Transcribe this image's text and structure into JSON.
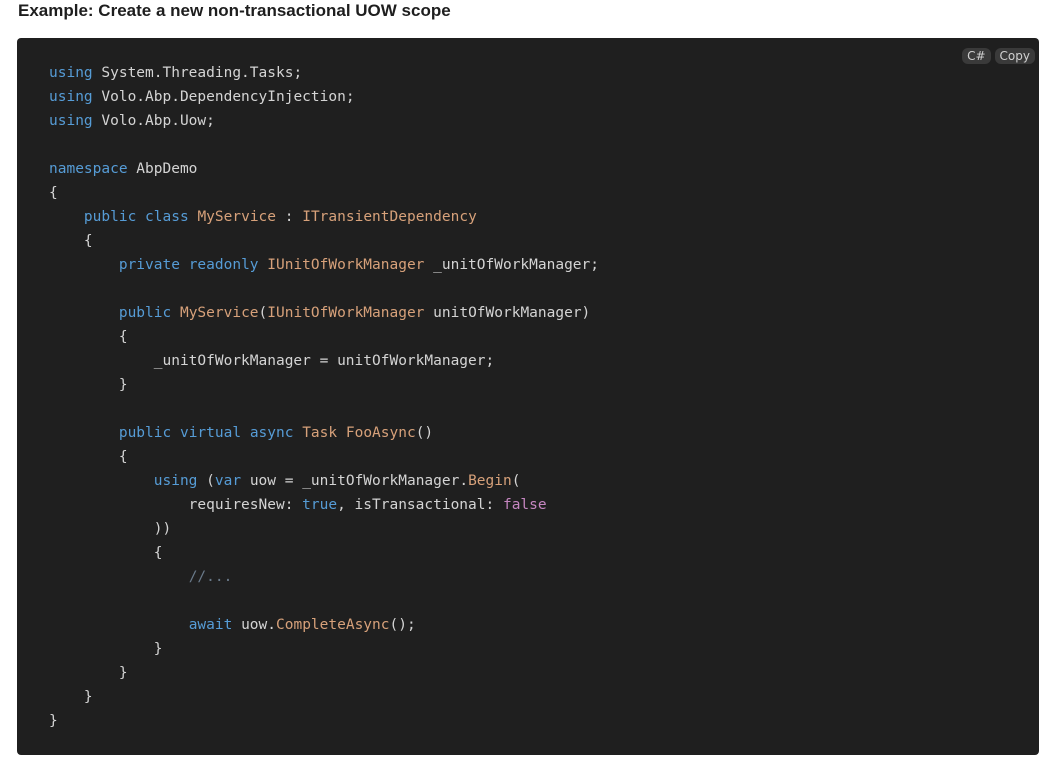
{
  "heading": "Example: Create a new non-transactional UOW scope",
  "toolbar": {
    "language": "C#",
    "copy_label": "Copy"
  },
  "colors": {
    "background": "#1f1f1f",
    "keyword": "#569cd6",
    "keyword_alt": "#c586c0",
    "type": "#d7a17a",
    "comment": "#6a7a8a",
    "text": "#d4d4d4"
  },
  "code_lines": [
    [
      [
        "keyword",
        "using"
      ],
      [
        "plain",
        " System.Threading.Tasks;"
      ]
    ],
    [
      [
        "keyword",
        "using"
      ],
      [
        "plain",
        " Volo.Abp.DependencyInjection;"
      ]
    ],
    [
      [
        "keyword",
        "using"
      ],
      [
        "plain",
        " Volo.Abp.Uow;"
      ]
    ],
    [],
    [
      [
        "keyword",
        "namespace"
      ],
      [
        "plain",
        " AbpDemo"
      ]
    ],
    [
      [
        "plain",
        "{"
      ]
    ],
    [
      [
        "plain",
        "    "
      ],
      [
        "keyword",
        "public"
      ],
      [
        "plain",
        " "
      ],
      [
        "keyword",
        "class"
      ],
      [
        "plain",
        " "
      ],
      [
        "type",
        "MyService"
      ],
      [
        "plain",
        " : "
      ],
      [
        "type",
        "ITransientDependency"
      ]
    ],
    [
      [
        "plain",
        "    {"
      ]
    ],
    [
      [
        "plain",
        "        "
      ],
      [
        "keyword",
        "private"
      ],
      [
        "plain",
        " "
      ],
      [
        "keyword",
        "readonly"
      ],
      [
        "plain",
        " "
      ],
      [
        "type",
        "IUnitOfWorkManager"
      ],
      [
        "plain",
        " _unitOfWorkManager;"
      ]
    ],
    [],
    [
      [
        "plain",
        "        "
      ],
      [
        "keyword",
        "public"
      ],
      [
        "plain",
        " "
      ],
      [
        "type",
        "MyService"
      ],
      [
        "plain",
        "("
      ],
      [
        "type",
        "IUnitOfWorkManager"
      ],
      [
        "plain",
        " unitOfWorkManager)"
      ]
    ],
    [
      [
        "plain",
        "        {"
      ]
    ],
    [
      [
        "plain",
        "            _unitOfWorkManager = unitOfWorkManager;"
      ]
    ],
    [
      [
        "plain",
        "        }"
      ]
    ],
    [],
    [
      [
        "plain",
        "        "
      ],
      [
        "keyword",
        "public"
      ],
      [
        "plain",
        " "
      ],
      [
        "keyword",
        "virtual"
      ],
      [
        "plain",
        " "
      ],
      [
        "keyword",
        "async"
      ],
      [
        "plain",
        " "
      ],
      [
        "type",
        "Task"
      ],
      [
        "plain",
        " "
      ],
      [
        "method",
        "FooAsync"
      ],
      [
        "plain",
        "()"
      ]
    ],
    [
      [
        "plain",
        "        {"
      ]
    ],
    [
      [
        "plain",
        "            "
      ],
      [
        "keyword",
        "using"
      ],
      [
        "plain",
        " ("
      ],
      [
        "keyword",
        "var"
      ],
      [
        "plain",
        " uow = _unitOfWorkManager."
      ],
      [
        "method",
        "Begin"
      ],
      [
        "plain",
        "("
      ]
    ],
    [
      [
        "plain",
        "                requiresNew: "
      ],
      [
        "keyword",
        "true"
      ],
      [
        "plain",
        ", isTransactional: "
      ],
      [
        "keyword2",
        "false"
      ]
    ],
    [
      [
        "plain",
        "            ))"
      ]
    ],
    [
      [
        "plain",
        "            {"
      ]
    ],
    [
      [
        "plain",
        "                "
      ],
      [
        "comment",
        "//..."
      ]
    ],
    [],
    [
      [
        "plain",
        "                "
      ],
      [
        "keyword",
        "await"
      ],
      [
        "plain",
        " uow."
      ],
      [
        "method",
        "CompleteAsync"
      ],
      [
        "plain",
        "();"
      ]
    ],
    [
      [
        "plain",
        "            }"
      ]
    ],
    [
      [
        "plain",
        "        }"
      ]
    ],
    [
      [
        "plain",
        "    }"
      ]
    ],
    [
      [
        "plain",
        "}"
      ]
    ]
  ]
}
